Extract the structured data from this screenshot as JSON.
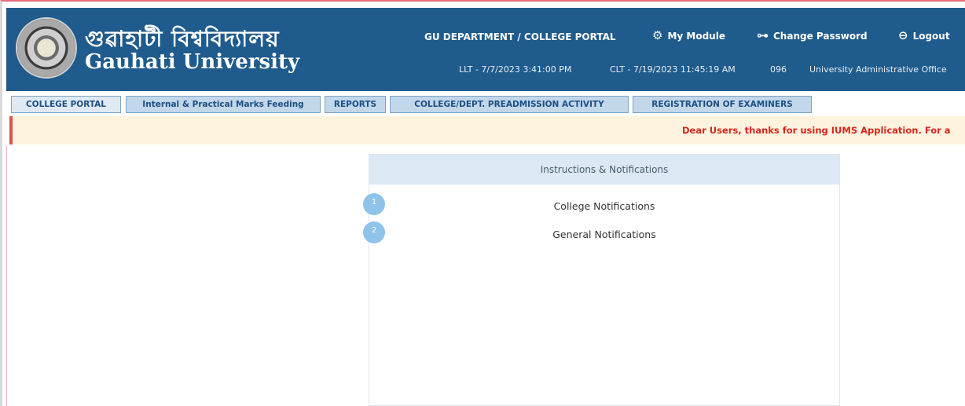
{
  "header": {
    "title_bengali": "গুৱাহাটী বিশ্ববিদ্যালয়",
    "title_english": "Gauhati University",
    "portal_title": "GU DEPARTMENT / COLLEGE PORTAL",
    "my_module": "My Module",
    "change_password": "Change Password",
    "logout": "Logout",
    "llt": "LLT - 7/7/2023 3:41:00 PM",
    "clt": "CLT - 7/19/2023 11:45:19 AM",
    "code": "096",
    "office": "University Administrative Office",
    "icons": {
      "my_module": "gear-icon",
      "change_password": "key-icon",
      "logout": "logout-icon"
    }
  },
  "tabs": [
    {
      "label": "COLLEGE PORTAL"
    },
    {
      "label": "Internal & Practical Marks Feeding"
    },
    {
      "label": "REPORTS"
    },
    {
      "label": "COLLEGE/DEPT. PREADMISSION ACTIVITY"
    },
    {
      "label": "REGISTRATION OF EXAMINERS"
    }
  ],
  "notice": {
    "text": "Dear Users, thanks for using IUMS Application. For a"
  },
  "panel": {
    "title": "Instructions & Notifications",
    "items": [
      {
        "number": "1",
        "label": "College Notifications"
      },
      {
        "number": "2",
        "label": "General Notifications"
      }
    ]
  },
  "colors": {
    "header_bg": "#1f5b8c",
    "tab_bg": "#c2d7ea",
    "notice_bg": "#fdf3df",
    "notice_text": "#d9251d",
    "bubble": "#8fc3e9"
  }
}
